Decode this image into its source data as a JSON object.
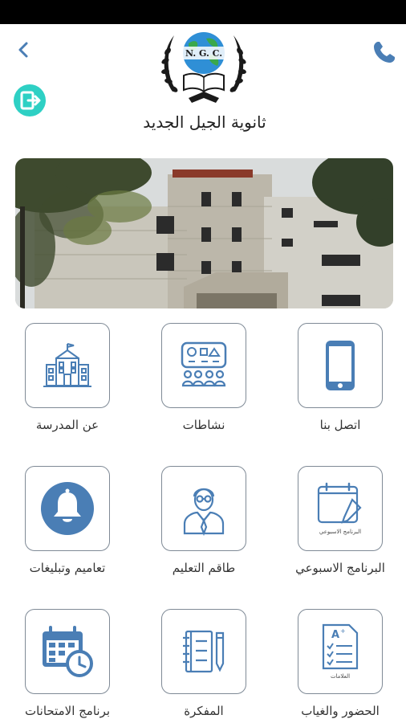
{
  "status_bar": {
    "time": ""
  },
  "header": {
    "school_name": "ثانوية الجيل الجديد",
    "logo_text": "N. G. C.",
    "accent": "#4a7eb5",
    "logout_color": "#2ed0c4"
  },
  "grid": {
    "items": [
      {
        "label": "اتصل بنا",
        "icon": "phone-icon"
      },
      {
        "label": "نشاطات",
        "icon": "activities-icon"
      },
      {
        "label": "عن المدرسة",
        "icon": "school-building-icon"
      },
      {
        "label": "البرنامج الاسبوعي",
        "icon": "weekly-schedule-icon",
        "icon_caption": "البرنامج الاسبوعي"
      },
      {
        "label": "طاقم التعليم",
        "icon": "teacher-icon"
      },
      {
        "label": "تعاميم وتبليغات",
        "icon": "bell-icon"
      },
      {
        "label": "الحضور والغياب",
        "icon": "attendance-icon",
        "icon_caption": "العلامات"
      },
      {
        "label": "المفكرة",
        "icon": "notebook-icon"
      },
      {
        "label": "برنامج الامتحانات",
        "icon": "exam-calendar-icon"
      }
    ]
  }
}
